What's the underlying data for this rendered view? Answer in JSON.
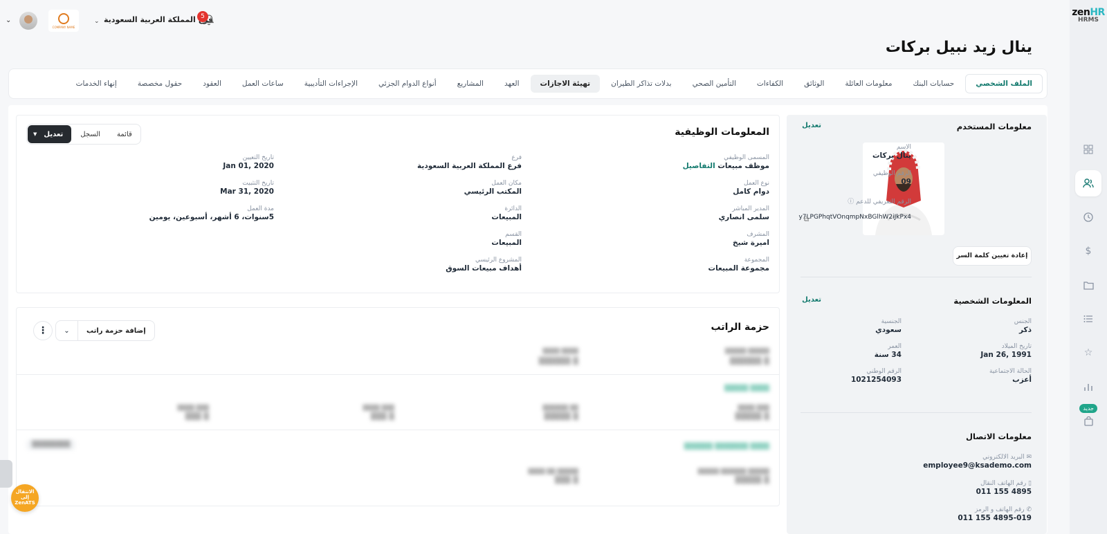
{
  "brand": {
    "logo_main": "zen",
    "logo_hr": "HR",
    "logo_sub": "HRMS"
  },
  "topbar": {
    "branch": "فرع المملكة العربية السعودية",
    "notifications_count": "5",
    "company_logo_text": "COMPANY NAME"
  },
  "page_title": "ينال زيد نبيل بركات",
  "tabs": [
    "الملف الشخصي",
    "حسابات البنك",
    "معلومات العائلة",
    "الوثائق",
    "الكفاءات",
    "التأمين الصحي",
    "بدلات تذاكر الطيران",
    "تهيئة الاجازات",
    "العهد",
    "المشاريع",
    "أنواع الدوام الجزئي",
    "الإجراءات التأديبية",
    "ساعات العمل",
    "العقود",
    "حقول مخصصة",
    "إنهاء الخدمات"
  ],
  "job_info": {
    "title": "المعلومات الوظيفية",
    "seg_list": "قائمة",
    "seg_history": "السجل",
    "seg_edit": "تعديل",
    "col1": [
      {
        "label": "المسمى الوظيفي",
        "value": "موظف مبيعات",
        "link": "التفاصيل"
      },
      {
        "label": "نوع العمل",
        "value": "دوام كامل"
      },
      {
        "label": "المدير المباشر",
        "value": "سلمى انصاري"
      },
      {
        "label": "المشرف",
        "value": "اميرة شيخ"
      },
      {
        "label": "المجموعة",
        "value": "مجموعة المبيعات"
      }
    ],
    "col2": [
      {
        "label": "فرع",
        "value": "فرع المملكة العربية السعودية"
      },
      {
        "label": "مكان العمل",
        "value": "المكتب الرئيسي"
      },
      {
        "label": "الدائرة",
        "value": "المبيعات"
      },
      {
        "label": "القسم",
        "value": "المبيعات"
      },
      {
        "label": "المشروع الرئيسي",
        "value": "أهداف مبيعات السوق"
      }
    ],
    "col3": [
      {
        "label": "تاريخ التعيين",
        "value": "Jan 01, 2020"
      },
      {
        "label": "تاريخ التثبيت",
        "value": "Mar 31, 2020"
      },
      {
        "label": "مدة العمل",
        "value": "5سنوات، 6 أشهر، أسبوعين، يومين"
      }
    ]
  },
  "salary": {
    "title": "حزمة الراتب",
    "add_button": "إضافة حزمة راتب",
    "kebab": "⋮"
  },
  "user_info": {
    "title": "معلومات المستخدم",
    "edit": "تعديل",
    "name_label": "الاسم",
    "name_value": "ينال بركات",
    "emp_no_label": "الرقم الوظيفي",
    "emp_no_value": "09",
    "support_id_label": "الرقم التعريفي للدعم ⓘ",
    "support_id_value": "y7LPGPhqtVOnqmpNxBGlhW2iJkPx4",
    "reset_password": "إعادة تعيين كلمة السر"
  },
  "personal_info": {
    "title": "المعلومات الشخصية",
    "edit": "تعديل",
    "fields": [
      {
        "label": "الجنس",
        "value": "ذكر"
      },
      {
        "label": "الجنسية",
        "value": "سعودي"
      },
      {
        "label": "تاريخ الميلاد",
        "value": "Jan 26, 1991"
      },
      {
        "label": "العمر",
        "value": "34 سنة"
      },
      {
        "label": "الحالة الاجتماعية",
        "value": "أعزب"
      },
      {
        "label": "الرقم الوطني",
        "value": "1021254093"
      }
    ]
  },
  "contact_info": {
    "title": "معلومات الاتصال",
    "email_label": "البريد الالكتروني",
    "email_value": "employee9@ksademo.com",
    "mobile_label": "رقم الهاتف النقال",
    "mobile_value": "011 155 4895",
    "phone_label": "رقم الهاتف و الرمز",
    "phone_value": "011 155 4895-019"
  },
  "side_nav": {
    "new_badge": "جديد"
  },
  "ats": {
    "line1": "الانتقال إلى",
    "line2": "ZenATS"
  }
}
